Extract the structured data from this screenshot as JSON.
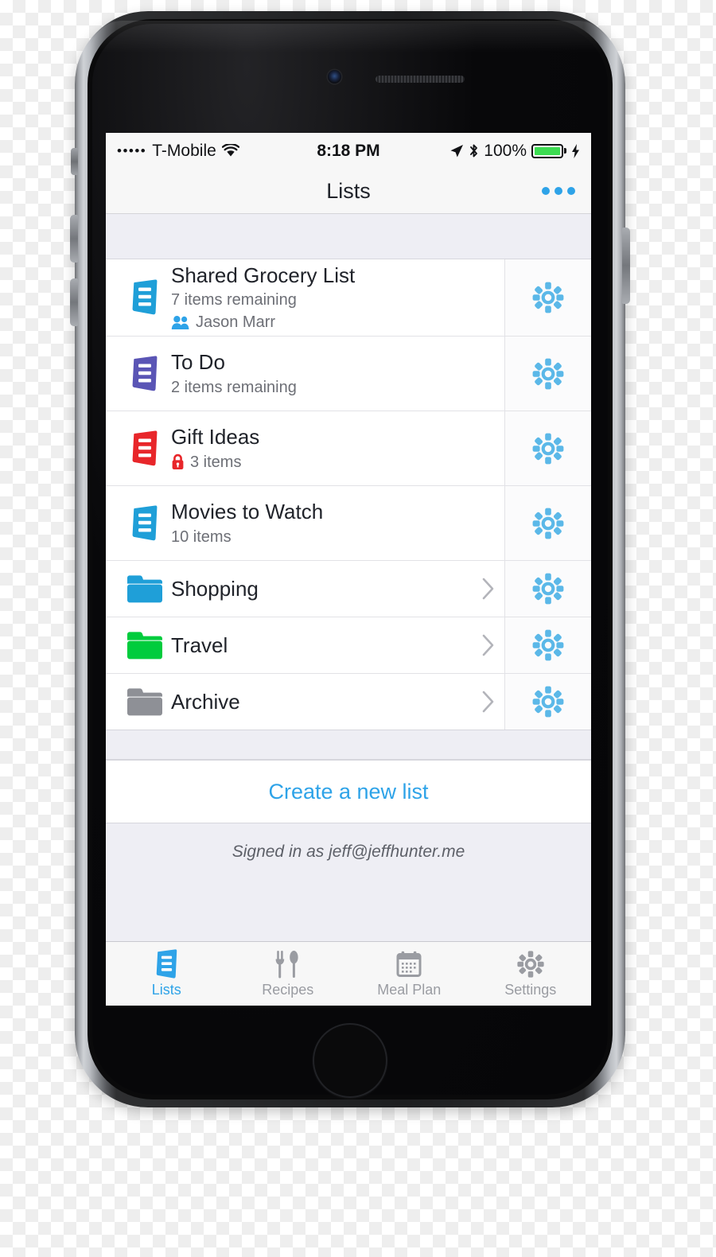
{
  "status_bar": {
    "signal_dots": "•••••",
    "carrier": "T-Mobile",
    "wifi_icon": "wifi-icon",
    "time": "8:18 PM",
    "location_icon": "location-arrow-icon",
    "bluetooth_icon": "bluetooth-icon",
    "battery_percent": "100%",
    "charging_icon": "lightning-bolt-icon",
    "battery_color": "#3ddc52"
  },
  "nav_bar": {
    "title": "Lists",
    "more_button": "more-options-button"
  },
  "colors": {
    "accent": "#2ea3e8",
    "gear": "#5bb8e8",
    "list_blue": "#1f9fd8",
    "list_purple": "#5a55b5",
    "list_red": "#e8262a",
    "folder_blue": "#1f9fd8",
    "folder_green": "#00cc3d",
    "folder_gray": "#8e9096",
    "lock_red": "#e8262a",
    "shared_blue": "#2ea3e8",
    "band": "#eeeef4"
  },
  "lists": [
    {
      "name": "Shared Grocery List",
      "subtitle": "7 items remaining",
      "shared_with": "Jason Marr",
      "shared_icon": "people-icon",
      "icon": "list-icon",
      "icon_color": "#1f9fd8",
      "type": "list",
      "locked": false,
      "gear": "settings-gear-icon"
    },
    {
      "name": "To Do",
      "subtitle": "2 items remaining",
      "shared_with": "",
      "icon": "list-icon",
      "icon_color": "#5a55b5",
      "type": "list",
      "locked": false,
      "gear": "settings-gear-icon"
    },
    {
      "name": "Gift Ideas",
      "subtitle": "3 items",
      "shared_with": "",
      "icon": "list-icon",
      "icon_color": "#e8262a",
      "type": "list",
      "locked": true,
      "lock_icon": "lock-icon",
      "gear": "settings-gear-icon"
    },
    {
      "name": "Movies to Watch",
      "subtitle": "10 items",
      "shared_with": "",
      "icon": "list-icon",
      "icon_color": "#1f9fd8",
      "type": "list",
      "locked": false,
      "gear": "settings-gear-icon"
    },
    {
      "name": "Shopping",
      "subtitle": "",
      "icon": "folder-icon",
      "icon_color": "#1f9fd8",
      "type": "folder",
      "chevron": "chevron-right-icon",
      "gear": "settings-gear-icon"
    },
    {
      "name": "Travel",
      "subtitle": "",
      "icon": "folder-icon",
      "icon_color": "#00cc3d",
      "type": "folder",
      "chevron": "chevron-right-icon",
      "gear": "settings-gear-icon"
    },
    {
      "name": "Archive",
      "subtitle": "",
      "icon": "folder-icon",
      "icon_color": "#8e9096",
      "type": "folder",
      "chevron": "chevron-right-icon",
      "gear": "settings-gear-icon"
    }
  ],
  "create_list": {
    "label": "Create a new list"
  },
  "footer": {
    "signed_in_text": "Signed in as jeff@jeffhunter.me"
  },
  "tab_bar": {
    "tabs": [
      {
        "label": "Lists",
        "icon": "list-icon",
        "active": true
      },
      {
        "label": "Recipes",
        "icon": "utensils-icon",
        "active": false
      },
      {
        "label": "Meal Plan",
        "icon": "calendar-icon",
        "active": false
      },
      {
        "label": "Settings",
        "icon": "gear-icon",
        "active": false
      }
    ]
  }
}
